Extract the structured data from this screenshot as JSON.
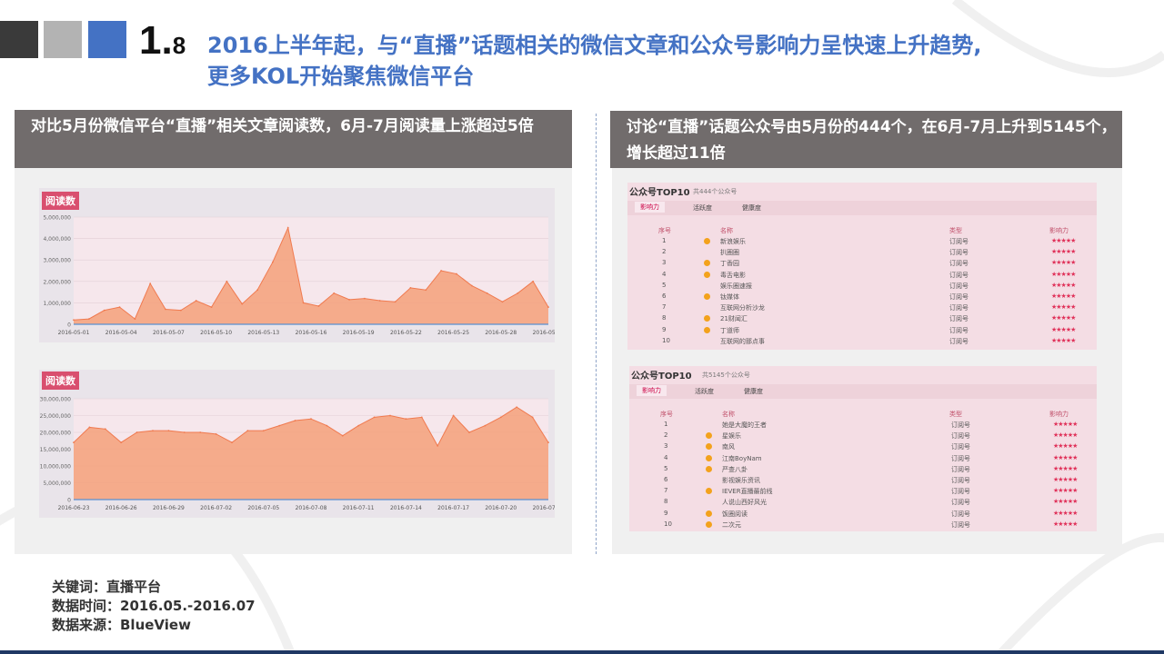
{
  "section_number": "1.",
  "section_number_small": "8",
  "title_line1": "2016上半年起，与“直播”话题相关的微信文章和公众号影响力呈快速上升趋势,",
  "title_line2": "更多KOL开始聚焦微信平台",
  "left_header": "对比5月份微信平台“直播”相关文章阅读数，6月-7月阅读量上涨超过5倍",
  "right_header": "讨论“直播”话题公众号由5月份的444个，在6月-7月上升到5145个，增长超过11倍",
  "colors": {
    "accent": "#4472c4",
    "header_bg": "#716c6c",
    "area": "#f4a07a",
    "badge": "#d94f6f",
    "star": "#e0325a"
  },
  "chart_data": [
    {
      "type": "area",
      "badge": "阅读数",
      "ylim": [
        0,
        5000000
      ],
      "yticks": [
        "5,000,000",
        "4,000,000",
        "3,000,000",
        "2,000,000",
        "1,000,000",
        "0"
      ],
      "xticks": [
        "2016-05-01",
        "2016-05-04",
        "2016-05-07",
        "2016-05-10",
        "2016-05-13",
        "2016-05-16",
        "2016-05-19",
        "2016-05-22",
        "2016-05-25",
        "2016-05-28",
        "2016-05-31"
      ],
      "values": [
        200000,
        250000,
        650000,
        800000,
        250000,
        1900000,
        700000,
        650000,
        1100000,
        800000,
        2000000,
        950000,
        1600000,
        2900000,
        4500000,
        1000000,
        850000,
        1450000,
        1150000,
        1200000,
        1100000,
        1050000,
        1700000,
        1600000,
        2500000,
        2350000,
        1800000,
        1450000,
        1050000,
        1450000,
        2000000,
        800000
      ]
    },
    {
      "type": "area",
      "badge": "阅读数",
      "ylim": [
        0,
        30000000
      ],
      "yticks": [
        "30,000,000",
        "25,000,000",
        "20,000,000",
        "15,000,000",
        "10,000,000",
        "5,000,000",
        "0"
      ],
      "xticks": [
        "2016-06-23",
        "2016-06-26",
        "2016-06-29",
        "2016-07-02",
        "2016-07-05",
        "2016-07-08",
        "2016-07-11",
        "2016-07-14",
        "2016-07-17",
        "2016-07-20",
        "2016-07-23"
      ],
      "values": [
        17000000,
        21500000,
        21000000,
        17000000,
        20000000,
        20500000,
        20500000,
        20000000,
        20000000,
        19500000,
        17000000,
        20500000,
        20500000,
        22000000,
        23500000,
        24000000,
        22000000,
        19000000,
        22000000,
        24500000,
        25000000,
        24000000,
        24500000,
        16000000,
        25000000,
        20000000,
        22000000,
        24500000,
        27500000,
        24500000,
        17000000
      ]
    }
  ],
  "top10_tables": [
    {
      "title": "公众号TOP10",
      "subtitle": "共444个公众号",
      "tabs": [
        "影响力",
        "活跃度",
        "健康度"
      ],
      "columns": [
        "序号",
        "名称",
        "类型",
        "影响力"
      ],
      "rows": [
        {
          "rank": "1",
          "name": "新浪娱乐",
          "type": "订阅号",
          "medal": true
        },
        {
          "rank": "2",
          "name": "扒圈圈",
          "type": "订阅号",
          "medal": false
        },
        {
          "rank": "3",
          "name": "丁香园",
          "type": "订阅号",
          "medal": true
        },
        {
          "rank": "4",
          "name": "毒舌电影",
          "type": "订阅号",
          "medal": true
        },
        {
          "rank": "5",
          "name": "娱乐圈速报",
          "type": "订阅号",
          "medal": false
        },
        {
          "rank": "6",
          "name": "钛媒体",
          "type": "订阅号",
          "medal": true
        },
        {
          "rank": "7",
          "name": "互联网分析沙龙",
          "type": "订阅号",
          "medal": false
        },
        {
          "rank": "8",
          "name": "21财闻汇",
          "type": "订阅号",
          "medal": true
        },
        {
          "rank": "9",
          "name": "丁道师",
          "type": "订阅号",
          "medal": true
        },
        {
          "rank": "10",
          "name": "互联网的那点事",
          "type": "订阅号",
          "medal": false
        }
      ],
      "stars": "★★★★★"
    },
    {
      "title": "公众号TOP10",
      "subtitle": "共5145个公众号",
      "tabs": [
        "影响力",
        "活跃度",
        "健康度"
      ],
      "columns": [
        "序号",
        "名称",
        "类型",
        "影响力"
      ],
      "rows": [
        {
          "rank": "1",
          "name": "她是大魔的王者",
          "type": "订阅号",
          "medal": false
        },
        {
          "rank": "2",
          "name": "星娱乐",
          "type": "订阅号",
          "medal": true
        },
        {
          "rank": "3",
          "name": "南风",
          "type": "订阅号",
          "medal": true
        },
        {
          "rank": "4",
          "name": "江南BoyNam",
          "type": "订阅号",
          "medal": true
        },
        {
          "rank": "5",
          "name": "严查八卦",
          "type": "订阅号",
          "medal": true
        },
        {
          "rank": "6",
          "name": "影视娱乐资讯",
          "type": "订阅号",
          "medal": false
        },
        {
          "rank": "7",
          "name": "IEVER直播最前线",
          "type": "订阅号",
          "medal": true
        },
        {
          "rank": "8",
          "name": "人说山西好风光",
          "type": "订阅号",
          "medal": false
        },
        {
          "rank": "9",
          "name": "饭圈阅读",
          "type": "订阅号",
          "medal": true
        },
        {
          "rank": "10",
          "name": "二次元",
          "type": "订阅号",
          "medal": true
        }
      ],
      "stars": "★★★★★"
    }
  ],
  "footer": {
    "keywords": "关键词：直播平台",
    "data_time": "数据时间：2016.05.-2016.07",
    "data_source": "数据来源：BlueView"
  }
}
